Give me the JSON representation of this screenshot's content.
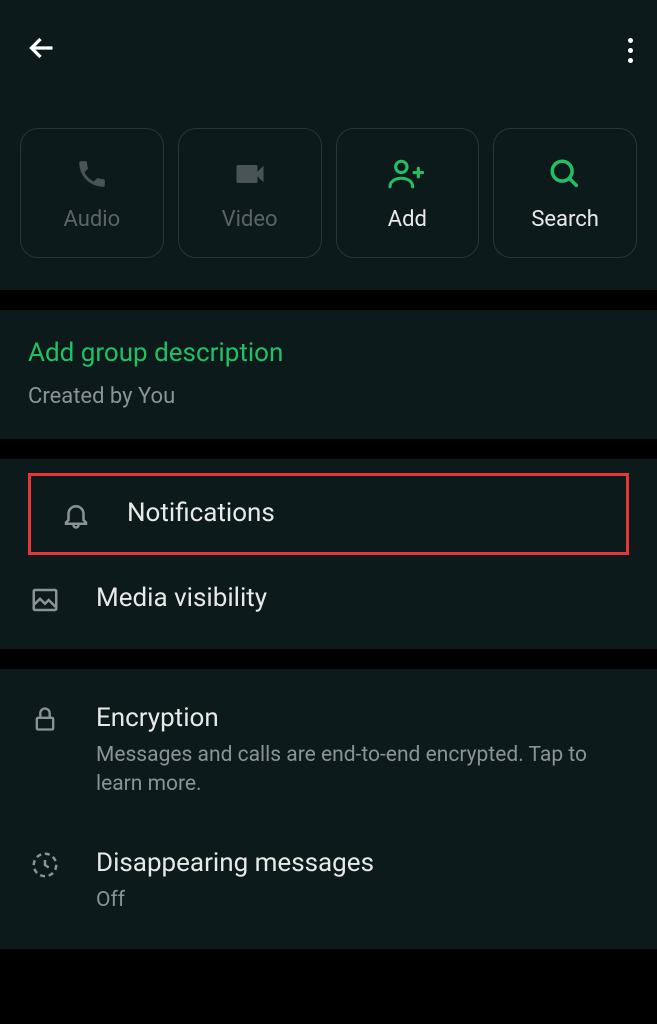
{
  "actions": {
    "audio": "Audio",
    "video": "Video",
    "add": "Add",
    "search": "Search"
  },
  "description": {
    "title": "Add group description",
    "subtitle": "Created by You"
  },
  "settings": {
    "notifications": "Notifications",
    "media_visibility": "Media visibility",
    "encryption": {
      "title": "Encryption",
      "subtitle": "Messages and calls are end-to-end encrypted. Tap to learn more."
    },
    "disappearing": {
      "title": "Disappearing messages",
      "subtitle": "Off"
    }
  }
}
